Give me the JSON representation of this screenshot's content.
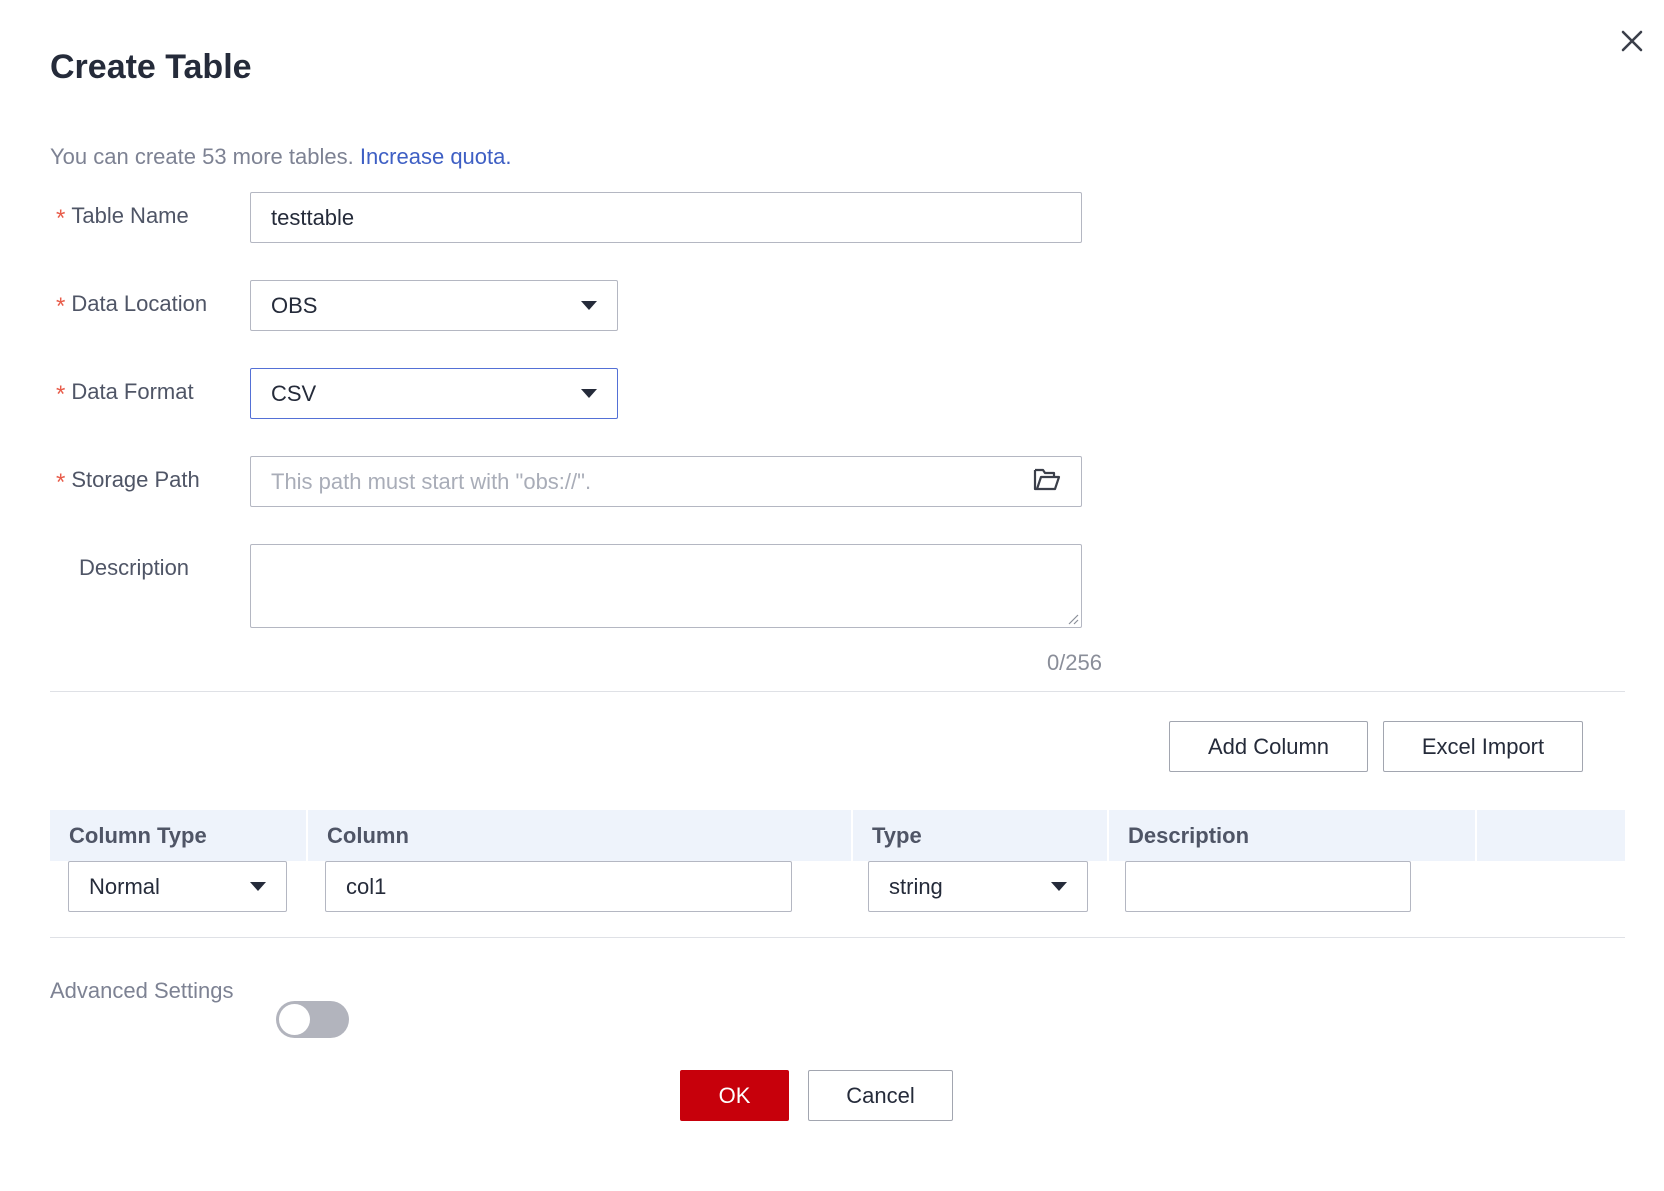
{
  "dialog": {
    "title": "Create Table"
  },
  "quota": {
    "text": "You can create 53 more tables. ",
    "link": "Increase quota."
  },
  "form": {
    "table_name": {
      "label": "Table Name",
      "value": "testtable"
    },
    "data_location": {
      "label": "Data Location",
      "value": "OBS"
    },
    "data_format": {
      "label": "Data Format",
      "value": "CSV"
    },
    "storage_path": {
      "label": "Storage Path",
      "placeholder": "This path must start with \"obs://\"."
    },
    "description": {
      "label": "Description",
      "value": "",
      "counter": "0/256"
    }
  },
  "columns": {
    "add_column_label": "Add Column",
    "excel_import_label": "Excel Import",
    "headers": [
      "Column Type",
      "Column",
      "Type",
      "Description"
    ],
    "rows": [
      {
        "column_type": "Normal",
        "column": "col1",
        "type": "string",
        "description": ""
      }
    ]
  },
  "advanced": {
    "label": "Advanced Settings",
    "enabled": false
  },
  "footer": {
    "ok_label": "OK",
    "cancel_label": "Cancel"
  },
  "colors": {
    "primary": "#c7000b",
    "link": "#3e5fc4",
    "required": "#e85c4a",
    "focus_border": "#5470d6"
  },
  "icons": {
    "close": "close-icon",
    "folder": "folder-open-icon",
    "dropdown": "chevron-down-icon"
  }
}
